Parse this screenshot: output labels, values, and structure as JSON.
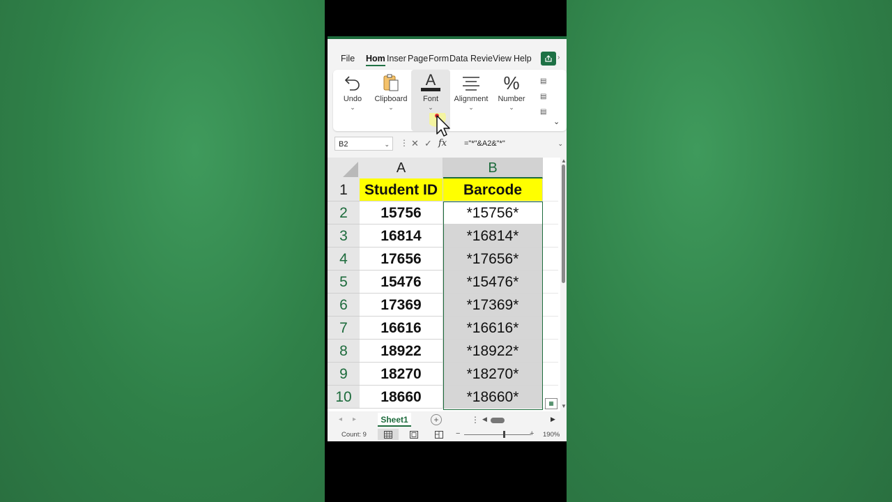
{
  "ribbon_tabs": [
    "File",
    "Hom",
    "Inser",
    "Page",
    "Form",
    "Data",
    "Revie",
    "View",
    "Help"
  ],
  "active_tab": "Hom",
  "ribbon_groups": [
    {
      "label": "Undo",
      "icon": "undo-icon"
    },
    {
      "label": "Clipboard",
      "icon": "clipboard-icon"
    },
    {
      "label": "Font",
      "icon": "font-color-icon"
    },
    {
      "label": "Alignment",
      "icon": "align-icon"
    },
    {
      "label": "Number",
      "icon": "percent-icon"
    }
  ],
  "formula_bar": {
    "name_box": "B2",
    "fx": "fx",
    "formula": "=\"*\"&A2&\"*\""
  },
  "columns": [
    "A",
    "B"
  ],
  "headers": {
    "a": "Student ID",
    "b": "Barcode"
  },
  "rows": [
    {
      "n": "1"
    },
    {
      "n": "2",
      "a": "15756",
      "b": "*15756*"
    },
    {
      "n": "3",
      "a": "16814",
      "b": "*16814*"
    },
    {
      "n": "4",
      "a": "17656",
      "b": "*17656*"
    },
    {
      "n": "5",
      "a": "15476",
      "b": "*15476*"
    },
    {
      "n": "6",
      "a": "17369",
      "b": "*17369*"
    },
    {
      "n": "7",
      "a": "16616",
      "b": "*16616*"
    },
    {
      "n": "8",
      "a": "18922",
      "b": "*18922*"
    },
    {
      "n": "9",
      "a": "18270",
      "b": "*18270*"
    },
    {
      "n": "10",
      "a": "18660",
      "b": "*18660*"
    }
  ],
  "sheet": {
    "name": "Sheet1"
  },
  "status": {
    "count": "Count: 9",
    "zoom": "190%"
  },
  "colors": {
    "excel_green": "#1d6b3c",
    "header_fill": "#ffff00",
    "selection_fill": "#d6d6d6"
  }
}
